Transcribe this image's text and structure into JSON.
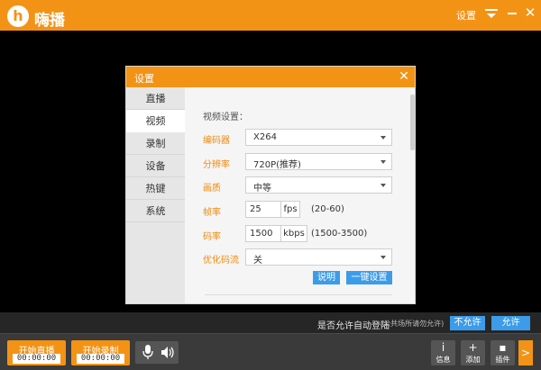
{
  "app": {
    "name": "嗨播",
    "logo_letter": "h",
    "titlebar": {
      "settings_label": "设置",
      "close_glyph": "✕"
    },
    "accent_color": "#f39316",
    "button_blue": "#3c9ce8"
  },
  "dialog": {
    "title": "设置",
    "close_glyph": "✕",
    "nav": [
      "直播",
      "视频",
      "录制",
      "设备",
      "热键",
      "系统"
    ],
    "active_nav": "视频",
    "section_title": "视频设置：",
    "fields": {
      "encoder": {
        "label": "编码器",
        "value": "X264"
      },
      "resolution": {
        "label": "分辨率",
        "value": "720P(推荐)"
      },
      "quality": {
        "label": "画质",
        "value": "中等"
      },
      "framerate": {
        "label": "帧率",
        "value": "25",
        "unit": "fps",
        "range": "(20-60)"
      },
      "bitrate": {
        "label": "码率",
        "value": "1500",
        "unit": "kbps",
        "range": "(1500-3500)"
      },
      "optimize": {
        "label": "优化码流",
        "value": "关"
      }
    },
    "buttons": {
      "explain": "说明",
      "one_click": "一键设置"
    }
  },
  "login_bar": {
    "question": "是否允许自动登陆",
    "note": "(公共场所请勿允许)",
    "deny": "不允许",
    "allow": "允许"
  },
  "toolbar": {
    "start_live": {
      "label": "开始直播",
      "time": "00:00:00"
    },
    "start_record": {
      "label": "开始录制",
      "time": "00:00:00"
    },
    "info": {
      "icon": "i",
      "label": "信息"
    },
    "add": {
      "icon": "+",
      "label": "添加"
    },
    "plugin": {
      "icon": "▪",
      "label": "插件"
    },
    "expand": ">"
  }
}
